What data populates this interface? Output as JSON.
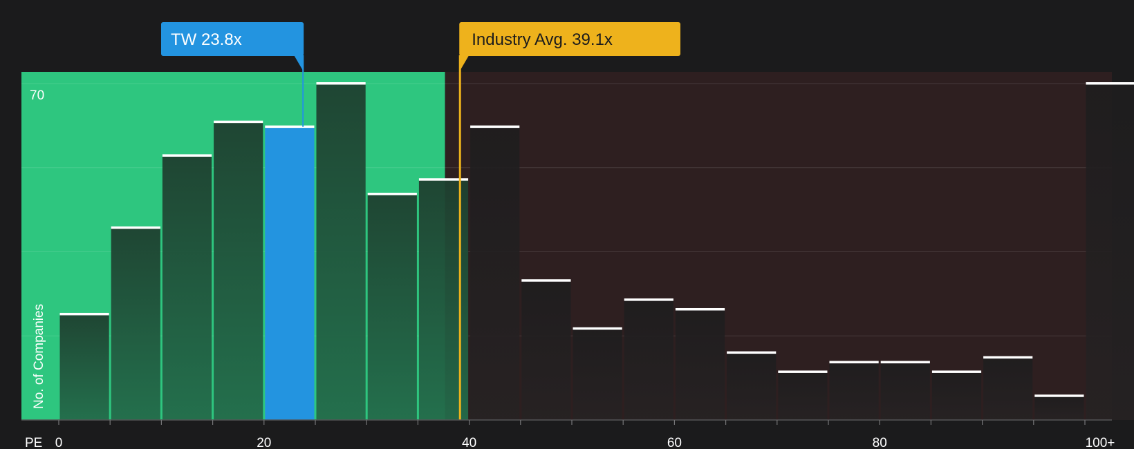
{
  "chart_data": {
    "type": "bar",
    "x_axis_label": "PE",
    "y_axis_label": "No. of Companies",
    "y_tick_label": "70",
    "y_max": 70,
    "bin_width": 5,
    "x_ticks": [
      {
        "value": 0,
        "label": "0"
      },
      {
        "value": 20,
        "label": "20"
      },
      {
        "value": 40,
        "label": "40"
      },
      {
        "value": 60,
        "label": "60"
      },
      {
        "value": 80,
        "label": "80"
      },
      {
        "value": 100,
        "label": "100+"
      }
    ],
    "bins": [
      {
        "start": 0,
        "end": 5,
        "count": 22
      },
      {
        "start": 5,
        "end": 10,
        "count": 40
      },
      {
        "start": 10,
        "end": 15,
        "count": 55
      },
      {
        "start": 15,
        "end": 20,
        "count": 62
      },
      {
        "start": 20,
        "end": 25,
        "count": 61
      },
      {
        "start": 25,
        "end": 30,
        "count": 70
      },
      {
        "start": 30,
        "end": 35,
        "count": 47
      },
      {
        "start": 35,
        "end": 40,
        "count": 50
      },
      {
        "start": 40,
        "end": 45,
        "count": 61
      },
      {
        "start": 45,
        "end": 50,
        "count": 29
      },
      {
        "start": 50,
        "end": 55,
        "count": 19
      },
      {
        "start": 55,
        "end": 60,
        "count": 25
      },
      {
        "start": 60,
        "end": 65,
        "count": 23
      },
      {
        "start": 65,
        "end": 70,
        "count": 14
      },
      {
        "start": 70,
        "end": 75,
        "count": 10
      },
      {
        "start": 75,
        "end": 80,
        "count": 12
      },
      {
        "start": 80,
        "end": 85,
        "count": 12
      },
      {
        "start": 85,
        "end": 90,
        "count": 10
      },
      {
        "start": 90,
        "end": 95,
        "count": 13
      },
      {
        "start": 95,
        "end": 100,
        "count": 5
      },
      {
        "start": 100,
        "end": 105,
        "count": 70
      }
    ],
    "highlight_bin_start": 20,
    "green_zone_end": 37.5,
    "company": {
      "label": "TW 23.8x",
      "value": 23.8,
      "color": "#2394e0"
    },
    "industry": {
      "label": "Industry Avg. 39.1x",
      "value": 39.1,
      "color": "#eeb21c"
    },
    "colors": {
      "background": "#1b1b1c",
      "green_zone": "#2ec67f",
      "red_zone": "#2e1f20",
      "bar_in_green": "#1e4a35",
      "bar_in_red": "#222021",
      "bar_top": "#ffffff"
    },
    "grid": true
  }
}
